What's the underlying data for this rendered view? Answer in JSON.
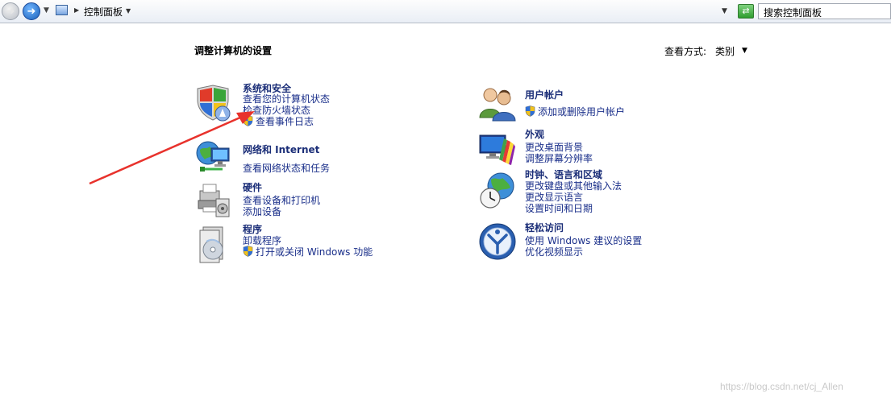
{
  "address_bar": {
    "breadcrumb": "控制面板",
    "search_placeholder": "搜索控制面板"
  },
  "header": {
    "title": "调整计算机的设置",
    "view_label": "查看方式:",
    "view_value": "类别"
  },
  "categories": [
    {
      "title": "系统和安全",
      "icon": "system-security-icon",
      "links": [
        "查看您的计算机状态",
        "检查防火墙状态",
        "查看事件日志"
      ]
    },
    {
      "title": "网络和 Internet",
      "icon": "network-icon",
      "links": [
        "查看网络状态和任务"
      ]
    },
    {
      "title": "硬件",
      "icon": "hardware-icon",
      "links": [
        "查看设备和打印机",
        "添加设备"
      ]
    },
    {
      "title": "程序",
      "icon": "programs-icon",
      "links": [
        "卸载程序",
        "打开或关闭 Windows 功能"
      ]
    },
    {
      "title": "用户帐户",
      "icon": "user-accounts-icon",
      "links": [
        "添加或删除用户帐户"
      ]
    },
    {
      "title": "外观",
      "icon": "appearance-icon",
      "links": [
        "更改桌面背景",
        "调整屏幕分辨率"
      ]
    },
    {
      "title": "时钟、语言和区域",
      "icon": "clock-language-icon",
      "links": [
        "更改键盘或其他输入法",
        "更改显示语言",
        "设置时间和日期"
      ]
    },
    {
      "title": "轻松访问",
      "icon": "ease-of-access-icon",
      "links": [
        "使用 Windows 建议的设置",
        "优化视频显示"
      ]
    }
  ],
  "watermark": "https://blog.csdn.net/cj_Allen",
  "colors": {
    "link": "#1a2f8a",
    "title": "#1b2e78",
    "annotation_arrow": "#e8322c"
  }
}
